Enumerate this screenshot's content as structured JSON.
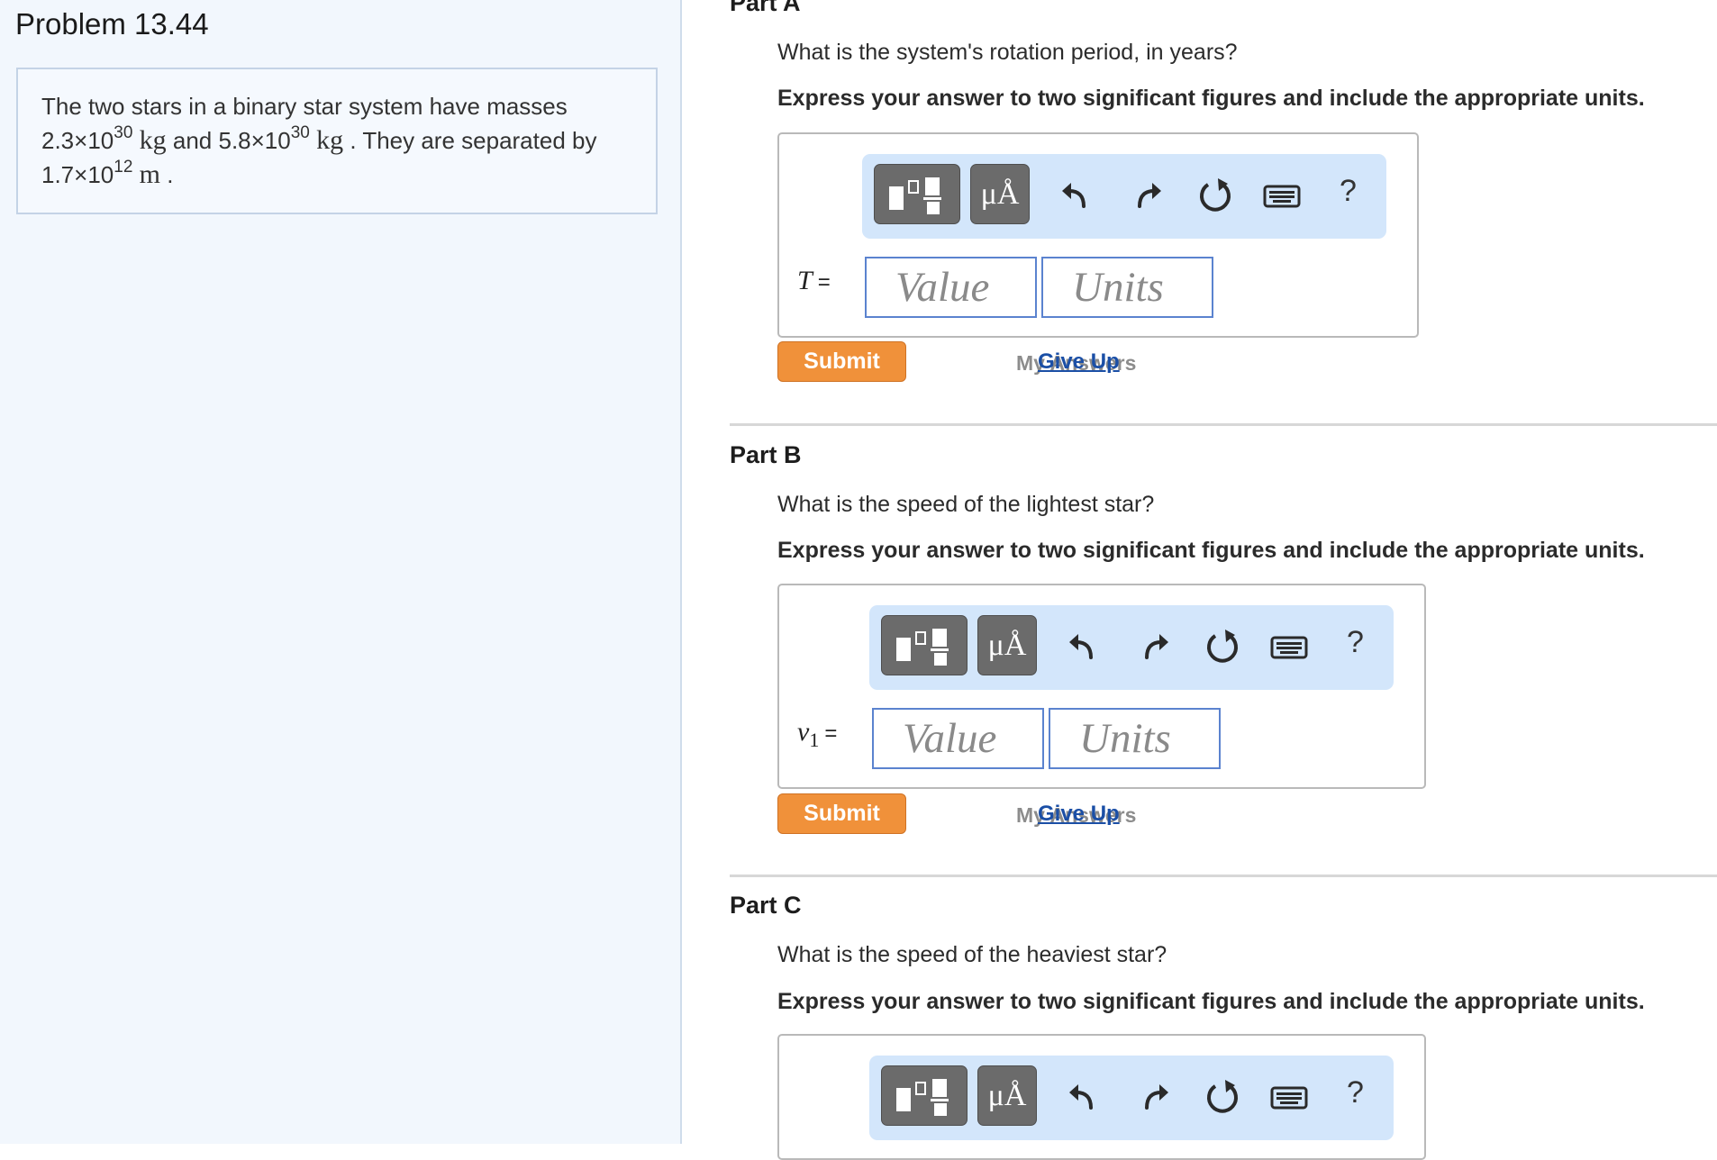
{
  "problem": {
    "title": "Problem 13.44",
    "text_1": "The two stars in a binary star system have masses",
    "mass1_mantissa": "2.3×10",
    "mass1_exp": "30",
    "mass_unit": "kg",
    "and": "and",
    "mass2_mantissa": "5.8×10",
    "mass2_exp": "30",
    "separated": ". They are separated by",
    "dist_mantissa": "1.7×10",
    "dist_exp": "12",
    "dist_unit": "m",
    "period": "."
  },
  "parts": [
    {
      "title": "Part A",
      "question": "What is the system's rotation period, in years?",
      "instruction": "Express your answer to two significant figures and include the appropriate units.",
      "var": "T",
      "var_sub": "",
      "eq": "=",
      "value_placeholder": "Value",
      "units_placeholder": "Units"
    },
    {
      "title": "Part B",
      "question": "What is the speed of the lightest star?",
      "instruction": "Express your answer to two significant figures and include the appropriate units.",
      "var": "v",
      "var_sub": "1",
      "eq": "=",
      "value_placeholder": "Value",
      "units_placeholder": "Units"
    },
    {
      "title": "Part C",
      "question": "What is the speed of the heaviest star?",
      "instruction": "Express your answer to two significant figures and include the appropriate units."
    }
  ],
  "toolbar": {
    "units_label": "μÅ",
    "help_label": "?"
  },
  "actions": {
    "submit": "Submit",
    "my_answers": "My Answers",
    "give_up": "Give Up"
  },
  "colors": {
    "submit": "#f0913a",
    "link": "#1b4fa6",
    "toolbar_bg": "#d3e6fb",
    "field_border": "#5b83cf"
  }
}
